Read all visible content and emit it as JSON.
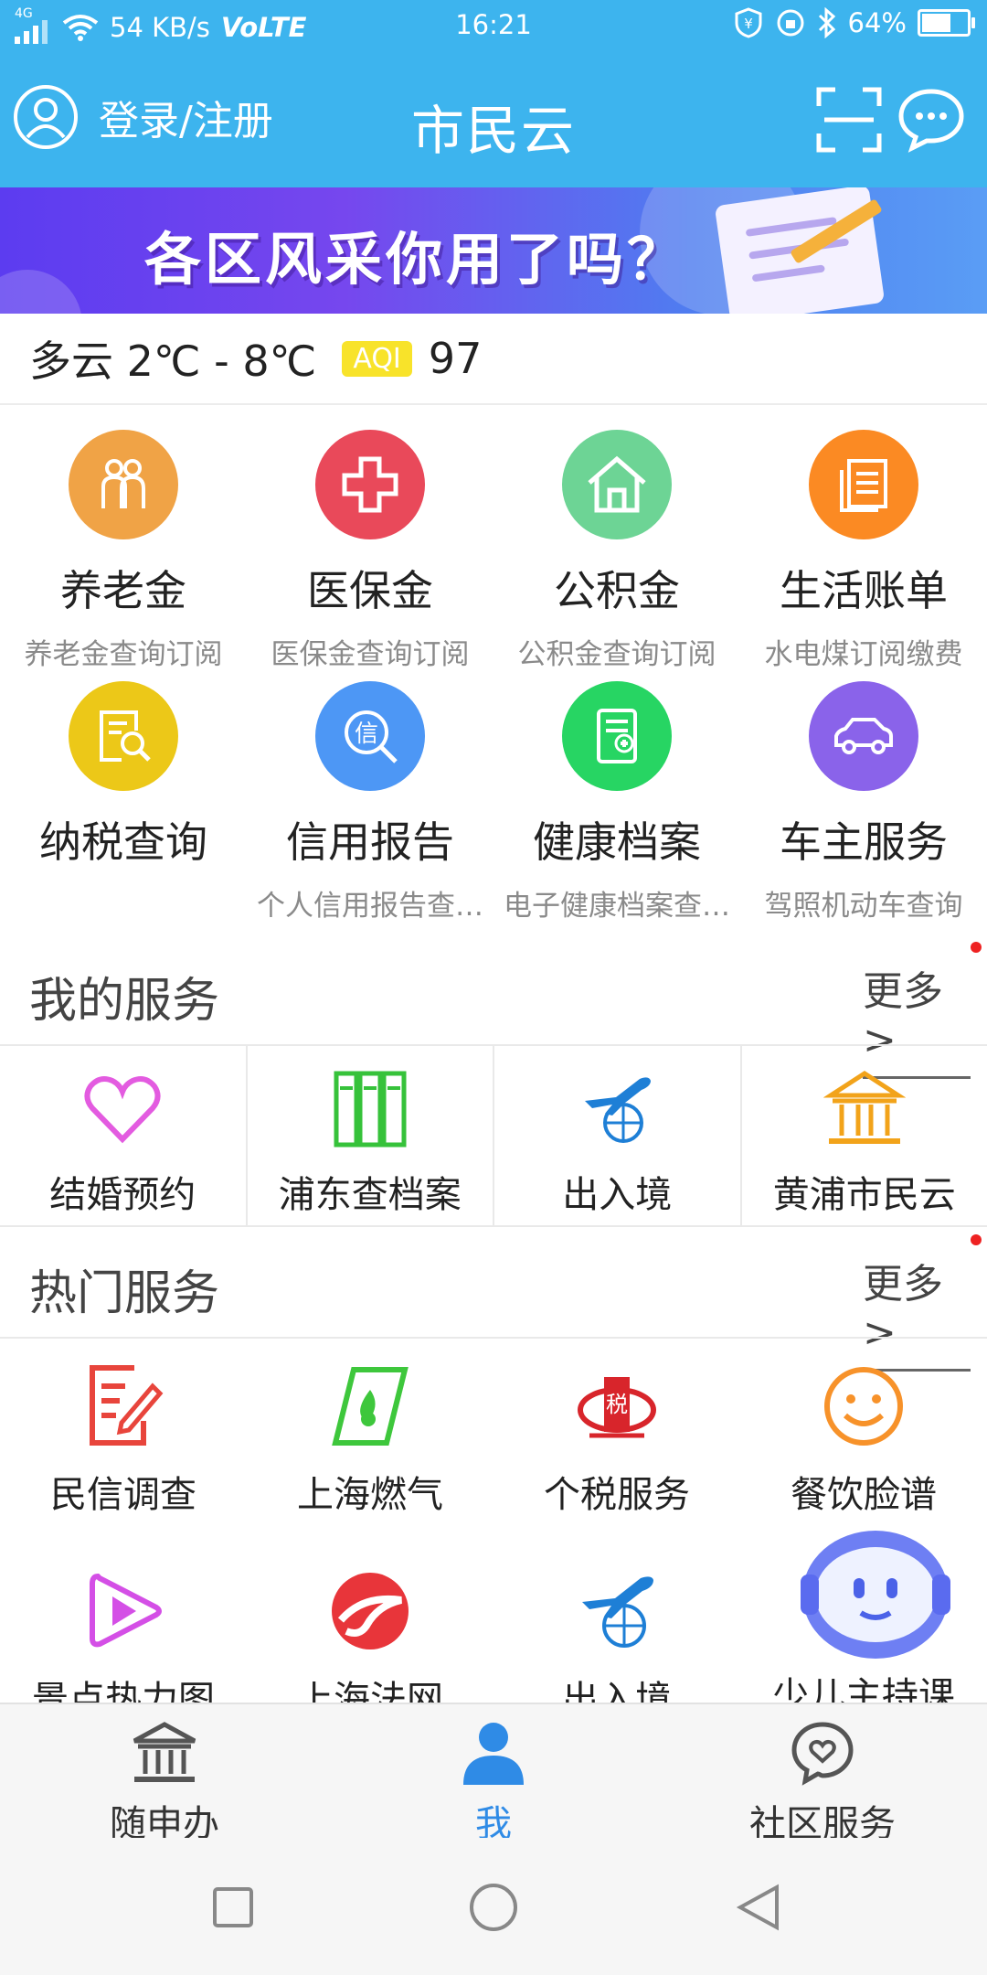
{
  "status_bar": {
    "network": "4G",
    "speed": "54 KB/s",
    "volte": "VoLTE",
    "time": "16:21",
    "battery": "64%"
  },
  "header": {
    "login_label": "登录/注册",
    "title": "市民云"
  },
  "banner": {
    "text": "各区风采你用了吗？"
  },
  "weather": {
    "condition": "多云 2℃ - 8℃",
    "aqi_label": "AQI",
    "aqi_value": "97"
  },
  "main_services": [
    {
      "title": "养老金",
      "subtitle": "养老金查询订阅",
      "color": "#f0a346",
      "icon": "elderly-icon"
    },
    {
      "title": "医保金",
      "subtitle": "医保金查询订阅",
      "color": "#e9495a",
      "icon": "medical-cross-icon"
    },
    {
      "title": "公积金",
      "subtitle": "公积金查询订阅",
      "color": "#6dd495",
      "icon": "house-icon"
    },
    {
      "title": "生活账单",
      "subtitle": "水电煤订阅缴费",
      "color": "#fb8a23",
      "icon": "bill-icon"
    },
    {
      "title": "纳税查询",
      "subtitle": "",
      "color": "#ecc818",
      "icon": "tax-search-icon"
    },
    {
      "title": "信用报告",
      "subtitle": "个人信用报告查…",
      "color": "#4d97f5",
      "icon": "credit-search-icon"
    },
    {
      "title": "健康档案",
      "subtitle": "电子健康档案查…",
      "color": "#27d563",
      "icon": "health-record-icon"
    },
    {
      "title": "车主服务",
      "subtitle": "驾照机动车查询",
      "color": "#8a63ea",
      "icon": "car-icon"
    }
  ],
  "my_services": {
    "title": "我的服务",
    "more": "更多>",
    "items": [
      {
        "label": "结婚预约",
        "icon": "heart-icon"
      },
      {
        "label": "浦东查档案",
        "icon": "archive-icon"
      },
      {
        "label": "出入境",
        "icon": "plane-globe-icon"
      },
      {
        "label": "黄浦市民云",
        "icon": "building-icon"
      }
    ]
  },
  "hot_services": {
    "title": "热门服务",
    "more": "更多>",
    "items": [
      {
        "label": "民信调查",
        "icon": "survey-icon"
      },
      {
        "label": "上海燃气",
        "icon": "gas-icon"
      },
      {
        "label": "个税服务",
        "icon": "tax-emblem-icon"
      },
      {
        "label": "餐饮脸谱",
        "icon": "smile-icon"
      },
      {
        "label": "景点热力图",
        "icon": "play-icon"
      },
      {
        "label": "上海法网",
        "icon": "law-icon"
      },
      {
        "label": "出入境",
        "icon": "plane-globe-icon"
      },
      {
        "label": "少儿主持课",
        "icon": "robot-icon"
      }
    ]
  },
  "bottom_nav": [
    {
      "label": "随申办",
      "icon": "government-icon"
    },
    {
      "label": "我",
      "icon": "person-icon",
      "active": true
    },
    {
      "label": "社区服务",
      "icon": "community-heart-icon"
    }
  ]
}
